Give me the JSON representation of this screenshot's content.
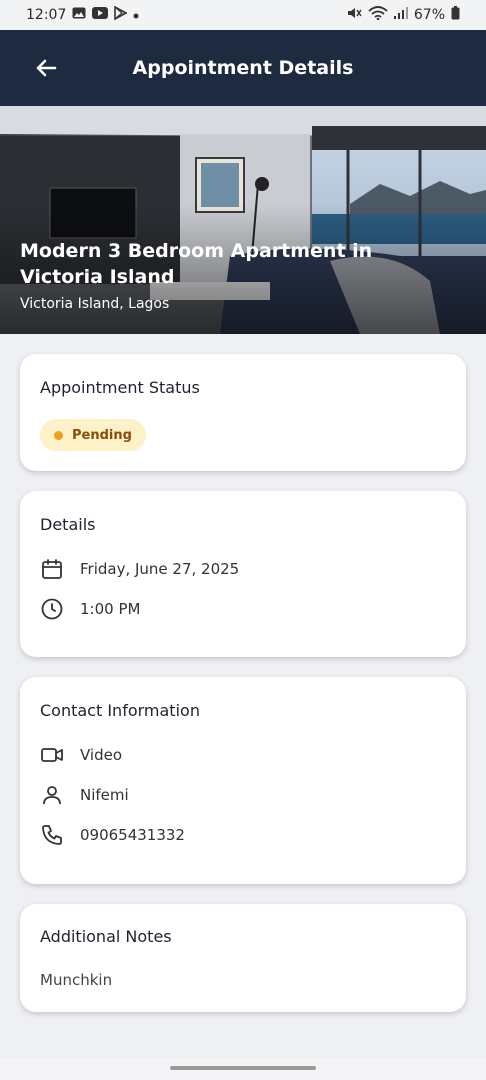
{
  "status_bar": {
    "time": "12:07",
    "battery": "67%"
  },
  "header": {
    "title": "Appointment Details"
  },
  "property": {
    "title": "Modern 3 Bedroom Apartment in Victoria Island",
    "location": "Victoria Island, Lagos"
  },
  "status_card": {
    "title": "Appointment Status",
    "badge": "Pending"
  },
  "details_card": {
    "title": "Details",
    "date": "Friday, June 27, 2025",
    "time": "1:00 PM"
  },
  "contact_card": {
    "title": "Contact Information",
    "type": "Video",
    "name": "Nifemi",
    "phone": "09065431332"
  },
  "notes_card": {
    "title": "Additional Notes",
    "text": "Munchkin"
  },
  "colors": {
    "header_bg": "#1e2a40",
    "badge_bg": "#fdf1c8",
    "badge_dot": "#f0a020",
    "badge_text": "#8a4e0c"
  }
}
